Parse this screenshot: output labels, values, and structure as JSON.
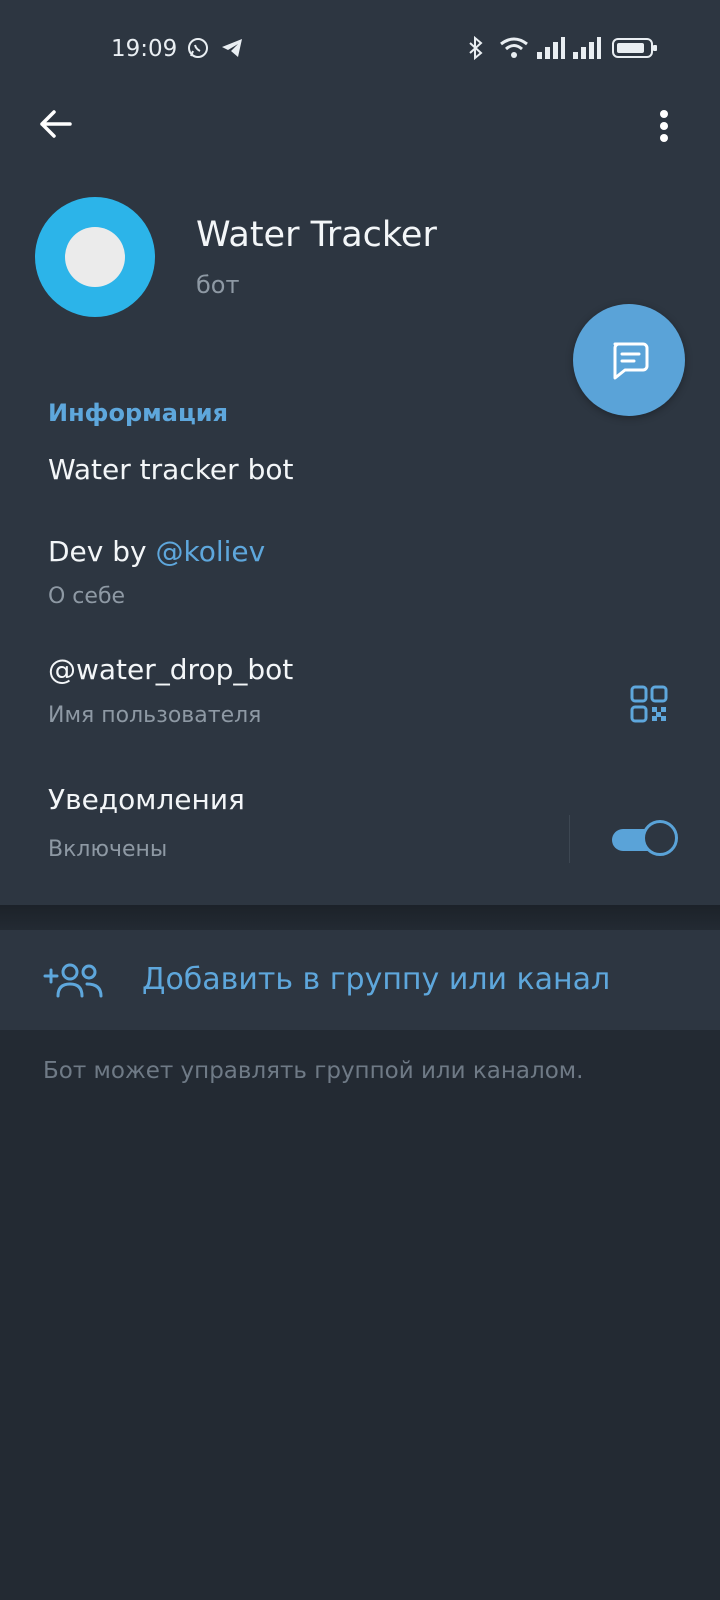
{
  "status_bar": {
    "time": "19:09",
    "icons": [
      "whatsapp-icon",
      "telegram-icon",
      "bluetooth-icon",
      "wifi-icon",
      "signal-icon",
      "signal-icon",
      "battery-icon"
    ]
  },
  "header": {
    "back_icon": "arrow-left-icon",
    "menu_icon": "more-vertical-icon"
  },
  "profile": {
    "name": "Water Tracker",
    "subtitle": "бот"
  },
  "fab": {
    "icon": "message-icon"
  },
  "info": {
    "section_title": "Информация",
    "description": "Water tracker bot",
    "about_prefix": "Dev by ",
    "about_link": "@koliev",
    "about_label": "О себе",
    "username": "@water_drop_bot",
    "username_label": "Имя пользователя",
    "notifications": "Уведомления",
    "notifications_state": "Включены",
    "notifications_on": true
  },
  "add_action": {
    "label": "Добавить в группу или канал",
    "icon": "add-user-group-icon"
  },
  "note": "Бот может управлять группой или каналом.",
  "colors": {
    "accent": "#5ea7dc",
    "background": "#232a33",
    "surface": "#2d3641",
    "avatar": "#2cb4e9"
  }
}
